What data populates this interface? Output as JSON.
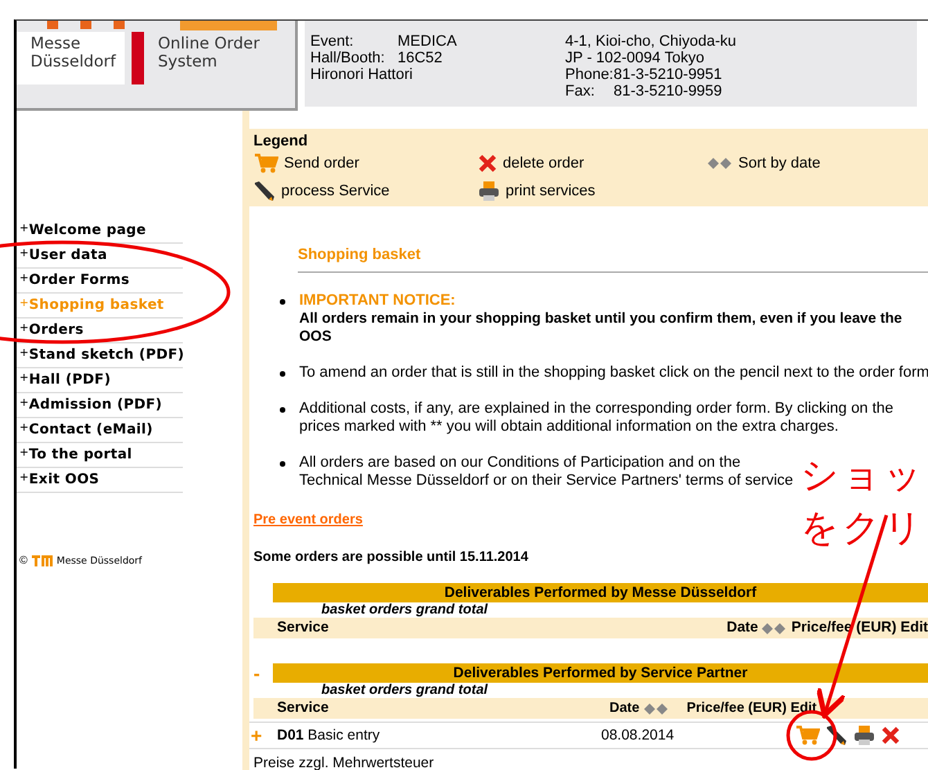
{
  "header": {
    "logo": {
      "brand": "Messe Düsseldorf",
      "product": "Online Order System"
    },
    "details": [
      {
        "label": "Event:",
        "value": "MEDICA"
      },
      {
        "label": "Hall/Booth:",
        "value": "16C52"
      },
      {
        "value": "Hironori Hattori"
      }
    ],
    "address": [
      {
        "value": "4-1, Kioi-cho, Chiyoda-ku"
      },
      {
        "value": "JP - 102-0094 Tokyo"
      },
      {
        "label": "Phone:",
        "value": "81-3-5210-9951"
      },
      {
        "label": "Fax:",
        "value": "81-3-5210-9959"
      }
    ]
  },
  "sidebar": {
    "items": [
      {
        "marker": "+",
        "label": "Welcome page",
        "selected": false
      },
      {
        "marker": "+",
        "label": "User data",
        "selected": false
      },
      {
        "marker": "+",
        "label": "Order Forms",
        "selected": false
      },
      {
        "marker": "+",
        "label": "Shopping basket",
        "selected": true
      },
      {
        "marker": "+",
        "label": "Orders",
        "selected": false
      },
      {
        "marker": "+",
        "label": "Stand sketch (PDF)",
        "selected": false
      },
      {
        "marker": "+",
        "label": "Hall (PDF)",
        "selected": false
      },
      {
        "marker": "+",
        "label": "Admission (PDF)",
        "selected": false
      },
      {
        "marker": "+",
        "label": "Contact (eMail)",
        "selected": false
      },
      {
        "marker": "+",
        "label": "To the portal",
        "selected": false
      },
      {
        "marker": "+",
        "label": "Exit OOS",
        "selected": false
      }
    ],
    "footer": {
      "copyright": "©",
      "company": "Messe Düsseldorf"
    }
  },
  "legend": {
    "title": "Legend",
    "items": [
      {
        "kind": "cart",
        "label": "Send order"
      },
      {
        "kind": "delete",
        "label": "delete order"
      },
      {
        "kind": "sort",
        "label": "Sort by date"
      },
      {
        "kind": "pencil",
        "label": "process Service"
      },
      {
        "kind": "print",
        "label": "print services"
      }
    ]
  },
  "page_title": "Shopping basket",
  "notices": [
    {
      "title": "IMPORTANT NOTICE:",
      "text": "All orders remain in your shopping basket until you confirm them, even if you leave the OOS"
    },
    {
      "text": "To amend an order that is still in the shopping basket click on the pencil next to the order form"
    },
    {
      "text": "Additional costs, if any, are explained in the corresponding order form. By clicking on the prices marked with ** you will obtain additional information on the extra charges."
    },
    {
      "text": "All orders are based on our Conditions of Participation and on the Technical Messe Düsseldorf or on their Service Partners' terms of service"
    }
  ],
  "pre_event_link": "Pre event orders",
  "deadline": "Some orders are possible until 15.11.2014",
  "sections": [
    {
      "title": "Deliverables Performed by Messe Düsseldorf",
      "expanded": false,
      "subtitle": "basket orders grand total",
      "columns": [
        "Service",
        "Date",
        "Price/fee (EUR) Edit"
      ]
    },
    {
      "title": "Deliverables Performed by Service Partner",
      "expanded": true,
      "subtitle": "basket orders grand total",
      "columns": [
        "Service",
        "Date",
        "Price/fee (EUR) Edit"
      ],
      "rows": [
        {
          "expander": "+",
          "code": "D01",
          "service": "Basic entry",
          "date": "08.08.2014"
        }
      ]
    }
  ],
  "expander_symbol": "-",
  "tax_note": "Preise zzgl. Mehrwertsteuer",
  "annotation_text": [
    "ショッ",
    "をクリ"
  ]
}
